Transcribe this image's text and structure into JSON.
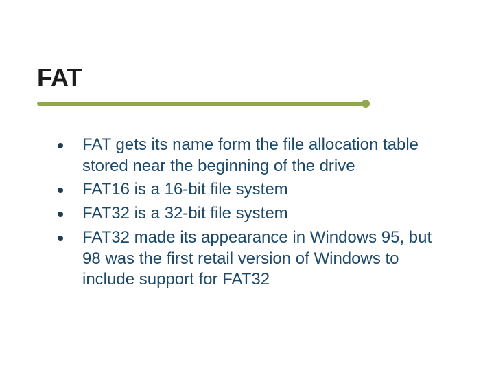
{
  "slide": {
    "title": "FAT",
    "bullets": [
      "FAT gets its name form the file allocation table stored near the beginning of the drive",
      "FAT16 is a 16-bit file system",
      "FAT32 is a 32-bit file system",
      "FAT32 made its appearance in Windows 95, but 98 was the first retail version of Windows to include support for FAT32"
    ]
  }
}
